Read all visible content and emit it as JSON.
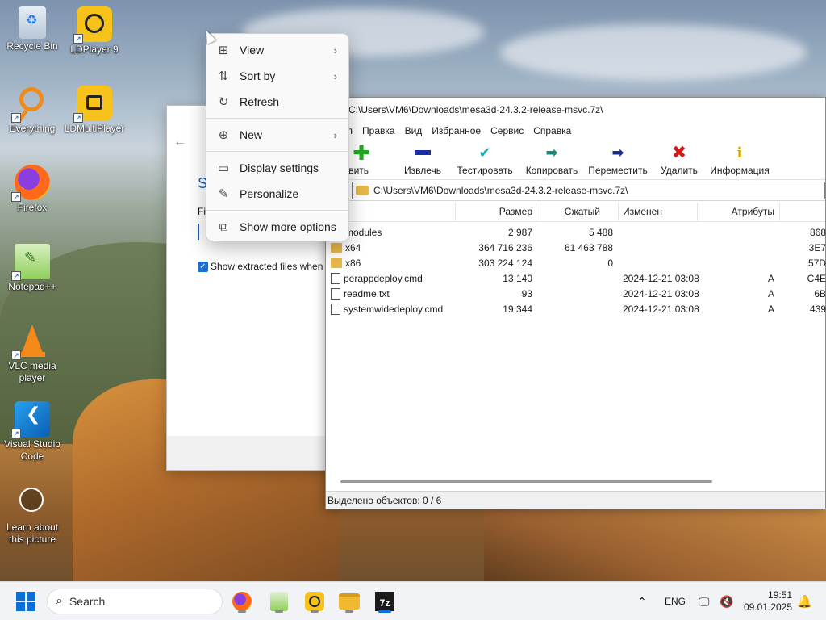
{
  "desktop": {
    "icons": [
      {
        "label": "Recycle Bin",
        "icon": "recycle-bin-icon"
      },
      {
        "label": "LDPlayer 9",
        "icon": "ldplayer-icon"
      },
      {
        "label": "Everything",
        "icon": "everything-search-icon"
      },
      {
        "label": "LDMultiPlayer",
        "icon": "ldmultiplayer-icon"
      },
      {
        "label": "Firefox",
        "icon": "firefox-icon"
      },
      {
        "label": "Notepad++",
        "icon": "notepadpp-icon"
      },
      {
        "label": "VLC media player",
        "icon": "vlc-icon"
      },
      {
        "label": "Visual Studio Code",
        "icon": "vscode-icon"
      },
      {
        "label": "Learn about this picture",
        "icon": "learn-about-picture-icon"
      }
    ]
  },
  "context_menu": {
    "items": [
      {
        "label": "View",
        "icon": "grid-view-icon",
        "has_submenu": true
      },
      {
        "label": "Sort by",
        "icon": "sort-icon",
        "has_submenu": true
      },
      {
        "label": "Refresh",
        "icon": "refresh-icon",
        "has_submenu": false
      },
      {
        "label": "New",
        "icon": "new-plus-icon",
        "has_submenu": true
      },
      {
        "label": "Display settings",
        "icon": "display-settings-icon",
        "has_submenu": false
      },
      {
        "label": "Personalize",
        "icon": "personalize-brush-icon",
        "has_submenu": false
      },
      {
        "label": "Show more options",
        "icon": "show-more-options-icon",
        "has_submenu": false
      }
    ]
  },
  "extract_dialog": {
    "heading_fragment": "S",
    "field_fragment": "Fi",
    "checkbox_label": "Show extracted files when c",
    "checkbox_checked": true
  },
  "zip_window": {
    "title": "C:\\Users\\VM6\\Downloads\\mesa3d-24.3.2-release-msvc.7z\\",
    "menu": [
      "л",
      "Правка",
      "Вид",
      "Избранное",
      "Сервис",
      "Справка"
    ],
    "toolbar": [
      {
        "label": "бавить",
        "icon": "add-plus-icon",
        "color": "#22aa22"
      },
      {
        "label": "Извлечь",
        "icon": "extract-minus-icon",
        "color": "#1a2ea8"
      },
      {
        "label": "Тестировать",
        "icon": "test-check-icon",
        "color": "#1aa8b8"
      },
      {
        "label": "Копировать",
        "icon": "copy-arrow-icon",
        "color": "#1a8a7a"
      },
      {
        "label": "Переместить",
        "icon": "move-arrow-icon",
        "color": "#1a2e8a"
      },
      {
        "label": "Удалить",
        "icon": "delete-x-icon",
        "color": "#d11a1a"
      },
      {
        "label": "Информация",
        "icon": "info-icon",
        "color": "#c8a000"
      }
    ],
    "address": "C:\\Users\\VM6\\Downloads\\mesa3d-24.3.2-release-msvc.7z\\",
    "columns": [
      "я",
      "Размер",
      "Сжатый",
      "Изменен",
      "Атрибуты"
    ],
    "rows": [
      {
        "name": "modules",
        "type": "folder",
        "size": "2 987",
        "packed": "5 488",
        "modified": "",
        "attr": "",
        "crc": "868"
      },
      {
        "name": "x64",
        "type": "folder",
        "size": "364 716 236",
        "packed": "61 463 788",
        "modified": "",
        "attr": "",
        "crc": "3E7"
      },
      {
        "name": "x86",
        "type": "folder",
        "size": "303 224 124",
        "packed": "0",
        "modified": "",
        "attr": "",
        "crc": "57D"
      },
      {
        "name": "perappdeploy.cmd",
        "type": "cmd",
        "size": "13 140",
        "packed": "",
        "modified": "2024-12-21 03:08",
        "attr": "A",
        "crc": "C4E"
      },
      {
        "name": "readme.txt",
        "type": "txt",
        "size": "93",
        "packed": "",
        "modified": "2024-12-21 03:08",
        "attr": "A",
        "crc": "6B"
      },
      {
        "name": "systemwidedeploy.cmd",
        "type": "cmd",
        "size": "19 344",
        "packed": "",
        "modified": "2024-12-21 03:08",
        "attr": "A",
        "crc": "439"
      }
    ],
    "status": "Выделено объектов: 0 / 6"
  },
  "taskbar": {
    "search_placeholder": "Search",
    "language": "ENG",
    "time": "19:51",
    "date": "09.01.2025"
  }
}
